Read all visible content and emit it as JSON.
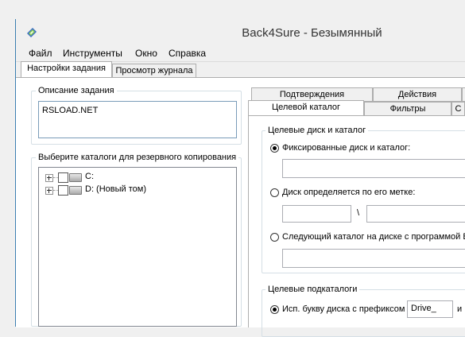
{
  "window": {
    "title": "Back4Sure - Безымянный"
  },
  "menu": [
    "Файл",
    "Инструменты",
    "Окно",
    "Справка"
  ],
  "tabs": [
    "Настройки задания",
    "Просмотр журнала"
  ],
  "task_description": {
    "title": "Описание задания",
    "value": "RSLOAD.NET"
  },
  "folders": {
    "title": "Выберите каталоги для резервного копирования",
    "items": [
      "C:",
      "D: (Новый том)"
    ]
  },
  "right_tabs_row1": [
    "Подтверждения",
    "Действия"
  ],
  "right_tabs_row2": [
    "Целевой каталог",
    "Фильтры",
    "С"
  ],
  "target_disk": {
    "title": "Целевые диск и каталог",
    "option1": "Фиксированные диск и каталог:",
    "option2": "Диск определяется по его метке:",
    "separator": "\\",
    "option3": "Следующий каталог на диске с программой B"
  },
  "target_subfolders": {
    "title": "Целевые подкаталоги",
    "option1": "Исп. букву диска с префиксом",
    "prefix": "Drive_",
    "trailing": "и"
  }
}
